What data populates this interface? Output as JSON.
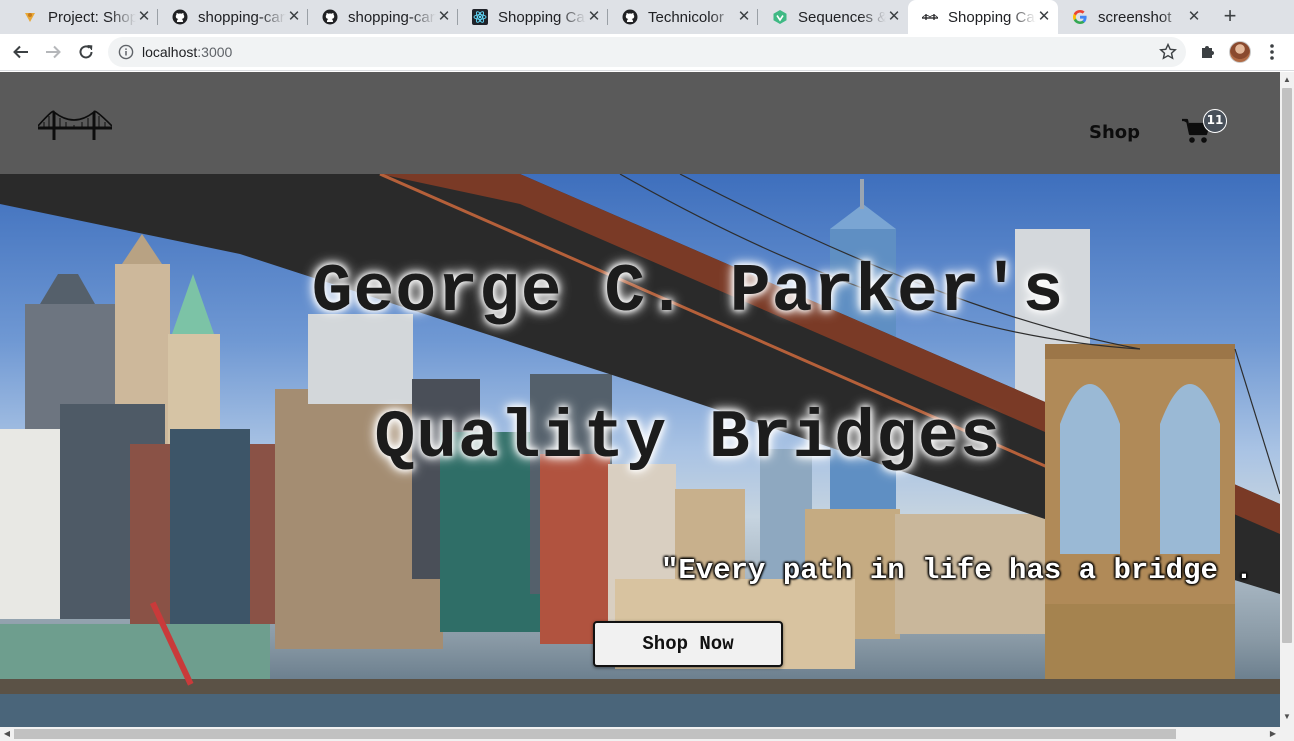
{
  "browser": {
    "tabs": [
      {
        "title": "Project: Shopping Cart",
        "icon": "odin-favicon-icon"
      },
      {
        "title": "shopping-cart",
        "icon": "github-icon"
      },
      {
        "title": "shopping-cart",
        "icon": "github-icon"
      },
      {
        "title": "Shopping Cart",
        "icon": "react-icon"
      },
      {
        "title": "Technicolor",
        "icon": "github-icon"
      },
      {
        "title": "Sequences &",
        "icon": "vue-icon"
      },
      {
        "title": "Shopping Cart",
        "icon": "bridge-favicon-icon",
        "active": true
      },
      {
        "title": "screenshot",
        "icon": "google-icon"
      }
    ],
    "close_glyph": "✕",
    "new_tab_glyph": "+",
    "address": {
      "host": "localhost",
      "port": ":3000"
    }
  },
  "navbar": {
    "shop_label": "Shop",
    "cart_count": "11"
  },
  "hero": {
    "title_line1": "George C. Parker's",
    "title_line2": "Quality Bridges",
    "quote": "\"Every path in life has a bridge .",
    "cta_label": "Shop Now"
  },
  "colors": {
    "navbar_bg": "#5a5a5a",
    "tabstrip_bg": "#dee1e6",
    "badge_bg": "#48505a"
  }
}
